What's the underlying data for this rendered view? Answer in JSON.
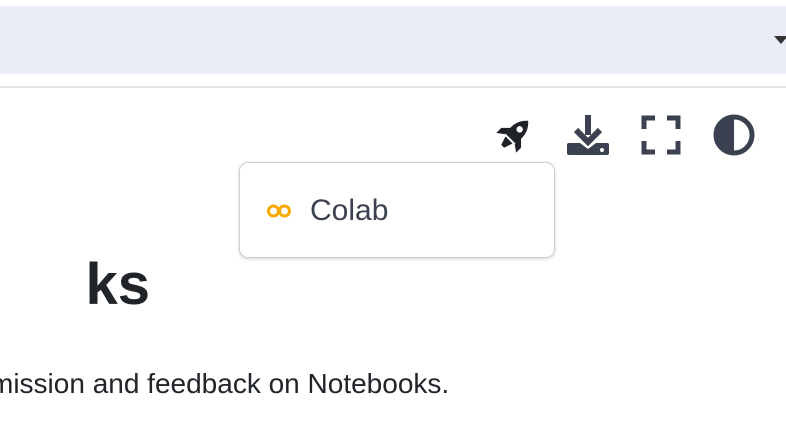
{
  "header": {
    "search_bar": ""
  },
  "toolbar": {
    "launch_icon": "rocket-icon",
    "download_icon": "download-icon",
    "fullscreen_icon": "fullscreen-icon",
    "theme_icon": "contrast-icon"
  },
  "launch_menu": {
    "items": [
      {
        "label": "Colab",
        "icon": "colab-icon",
        "icon_color": "#f9ab00"
      }
    ]
  },
  "content": {
    "heading": "ks",
    "description": "mission and feedback on Notebooks."
  },
  "colors": {
    "search_bar_bg": "#e9ebf5",
    "icon_color": "#3b4151",
    "text_color": "#212529"
  }
}
